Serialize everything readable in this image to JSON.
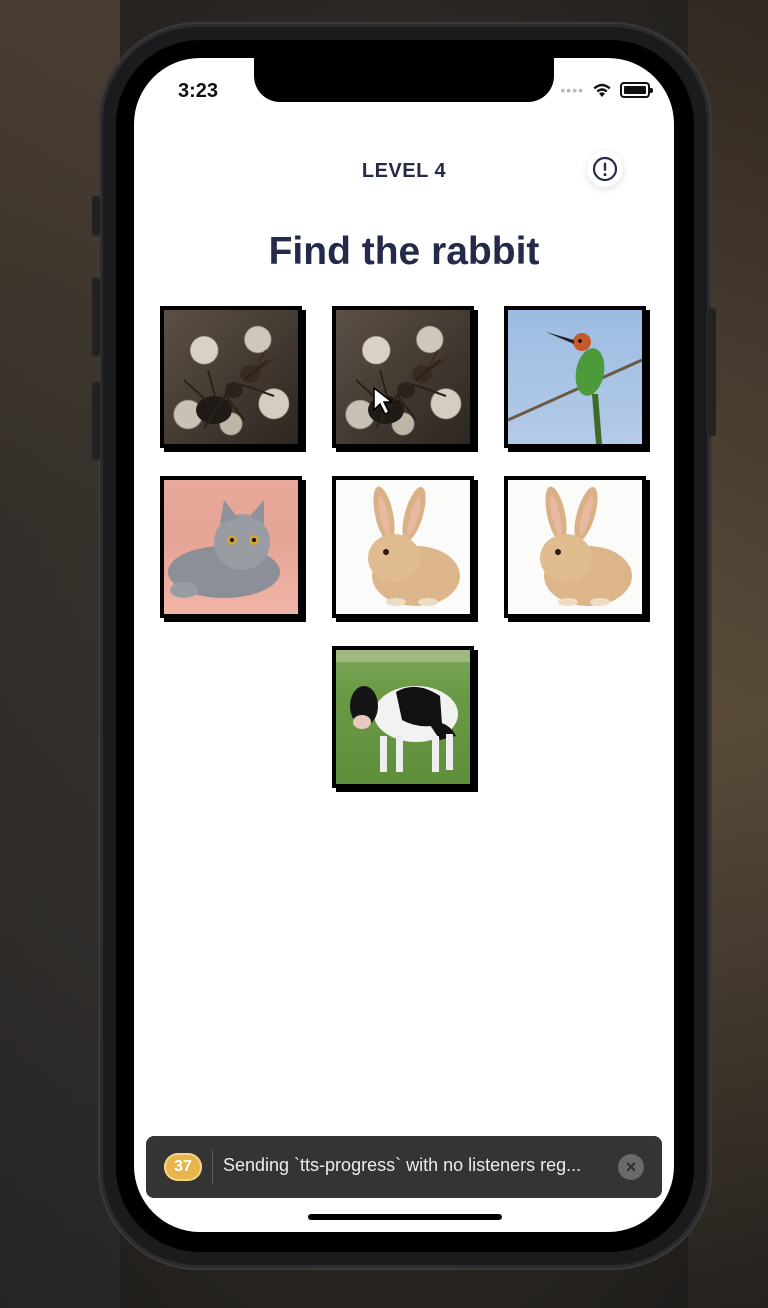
{
  "status_bar": {
    "time": "3:23"
  },
  "header": {
    "level": "LEVEL 4",
    "info_icon": "exclamation-circle-icon"
  },
  "prompt": "Find the rabbit",
  "tiles": [
    {
      "animal": "ant"
    },
    {
      "animal": "ant"
    },
    {
      "animal": "bird"
    },
    {
      "animal": "cat"
    },
    {
      "animal": "rabbit"
    },
    {
      "animal": "rabbit"
    },
    {
      "animal": "cow"
    }
  ],
  "log_box": {
    "count": "37",
    "message": "Sending `tts-progress` with no listeners reg...",
    "close_icon": "close-icon"
  },
  "colors": {
    "title": "#232a4a",
    "badge": "#e8b54b",
    "log_bg": "#343434"
  }
}
